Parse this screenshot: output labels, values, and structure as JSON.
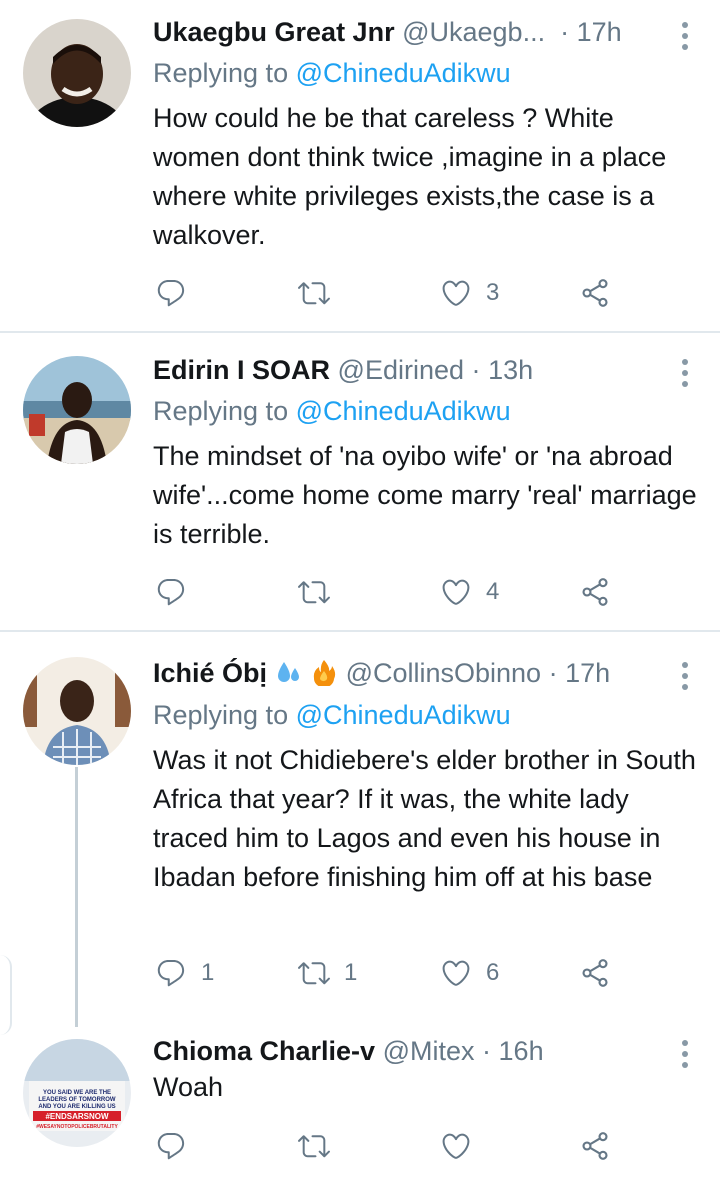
{
  "tweets": [
    {
      "name": "Ukaegbu Great Jnr",
      "handle": "@Ukaegb...",
      "dot": "·",
      "time": "17h",
      "replying_label": "Replying to",
      "replying_to": "@ChineduAdikwu",
      "text": "How could he be that careless ? White women dont think twice ,imagine in a place where white privileges exists,the case is a walkover.",
      "reply_count": "",
      "retweet_count": "",
      "like_count": "3"
    },
    {
      "name": "Edirin I SOAR",
      "handle": "@Edirined",
      "dot": "·",
      "time": "13h",
      "replying_label": "Replying to",
      "replying_to": "@ChineduAdikwu",
      "text": "The mindset of 'na oyibo wife' or 'na abroad wife'...come home come marry 'real' marriage is terrible.",
      "reply_count": "",
      "retweet_count": "",
      "like_count": "4"
    },
    {
      "name": "Ichié Óbị",
      "handle": "@CollinsObinno",
      "dot": "·",
      "time": "17h",
      "replying_label": "Replying to",
      "replying_to": "@ChineduAdikwu",
      "text": "Was it not Chidiebere's elder brother in South Africa that year? If it was, the white lady traced him to Lagos and even his house in Ibadan before finishing him off at his base",
      "reply_count": "1",
      "retweet_count": "1",
      "like_count": "6"
    },
    {
      "name": "Chioma Charlie-v",
      "handle": "@Mitex",
      "dot": "·",
      "time": "16h",
      "text": "Woah",
      "reply_count": "",
      "retweet_count": "",
      "like_count": ""
    }
  ],
  "avatar4_banner": {
    "line1": "YOU SAID WE ARE THE",
    "line2": "LEADERS OF TOMORROW",
    "line3": "AND YOU ARE KILLING US",
    "hashtag1": "#ENDSARSNOW",
    "hashtag2": "#WESAYNOTOPOLICEBRUTALITY"
  },
  "icons": {
    "reply": "reply-icon",
    "retweet": "retweet-icon",
    "like": "heart-icon",
    "share": "share-icon",
    "more": "more-vertical-icon"
  },
  "colors": {
    "link": "#1da1f2",
    "secondary": "#657786",
    "divider": "#e1e8ed"
  }
}
